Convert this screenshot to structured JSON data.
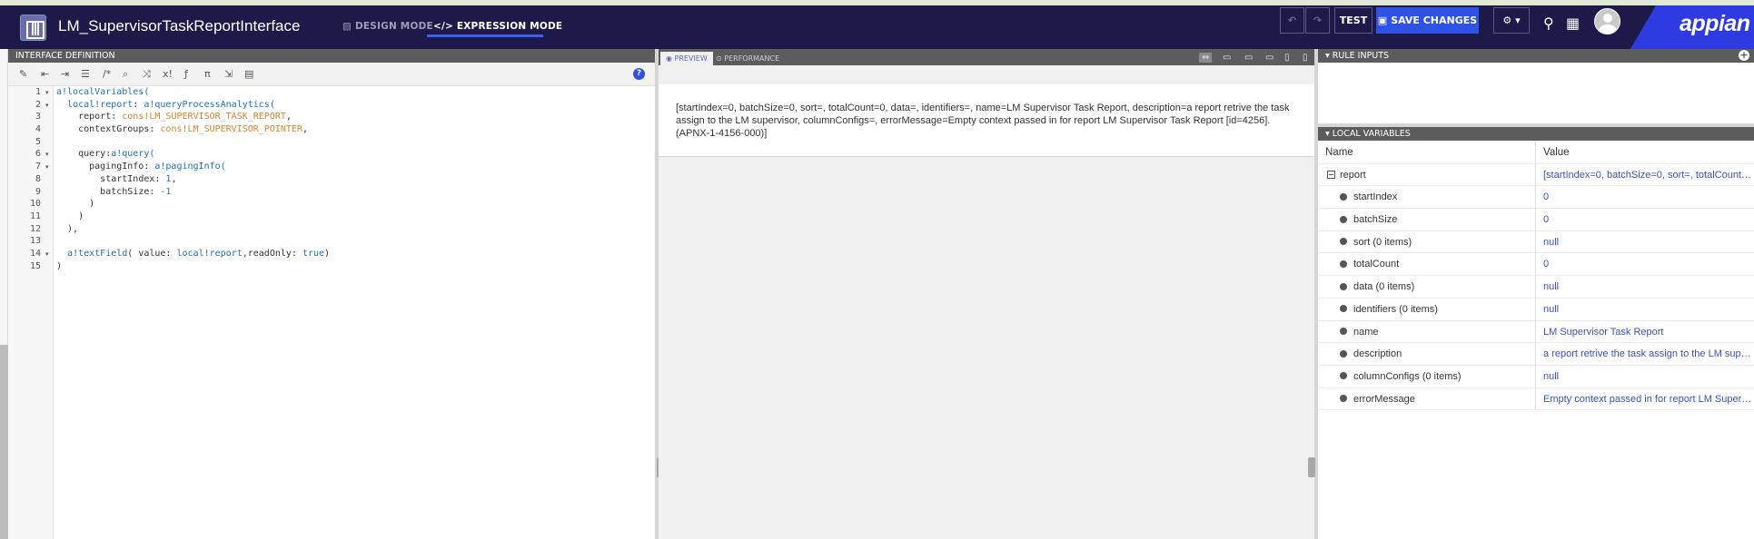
{
  "header": {
    "title": "LM_SupervisorTaskReportInterface",
    "design_mode": "DESIGN MODE",
    "expression_mode": "EXPRESSION MODE",
    "test_label": "TEST",
    "save_label": "SAVE CHANGES",
    "brand": "appian"
  },
  "editor": {
    "section_title": "INTERFACE DEFINITION",
    "line_numbers": [
      "1",
      "2",
      "3",
      "4",
      "5",
      "6",
      "7",
      "8",
      "9",
      "10",
      "11",
      "12",
      "13",
      "14",
      "15"
    ],
    "help": "?"
  },
  "preview": {
    "tab_preview": "PREVIEW",
    "tab_performance": "PERFORMANCE",
    "output": "[startIndex=0, batchSize=0, sort=, totalCount=0, data=, identifiers=, name=LM Supervisor Task Report, description=a report retrive the task assign to the LM supervisor, columnConfigs=, errorMessage=Empty context passed in for report LM Supervisor Task Report [id=4256]. (APNX-1-4156-000)]"
  },
  "rule_inputs": {
    "title": "RULE INPUTS",
    "add": "+"
  },
  "local_variables": {
    "title": "LOCAL VARIABLES",
    "col_name": "Name",
    "col_value": "Value",
    "report": {
      "name": "report",
      "value": "[startIndex=0, batchSize=0, sort=, totalCount=0, data=, identifiers=, name=LM Supervisor Task Report, description=a report retrive the task assign to the LM supervisor, columnConfigs=, errorMessage=...]"
    },
    "rows": [
      {
        "name": "startIndex",
        "value": "0"
      },
      {
        "name": "batchSize",
        "value": "0"
      },
      {
        "name": "sort (0 items)",
        "value": "null"
      },
      {
        "name": "totalCount",
        "value": "0"
      },
      {
        "name": "data (0 items)",
        "value": "null"
      },
      {
        "name": "identifiers (0 items)",
        "value": "null"
      },
      {
        "name": "name",
        "value": "LM Supervisor Task Report"
      },
      {
        "name": "description",
        "value": "a report retrive the task assign to the LM supervisor"
      },
      {
        "name": "columnConfigs (0 items)",
        "value": "null"
      },
      {
        "name": "errorMessage",
        "value": "Empty context passed in for report LM Supervisor Task Report [id=4256]. (APNX-1-4156-000)"
      }
    ]
  },
  "colors": {
    "topbar": "#1d1a4a",
    "accent": "#2f52e6",
    "section_header": "#5c5c5c",
    "value_link": "#3b4fc4"
  }
}
